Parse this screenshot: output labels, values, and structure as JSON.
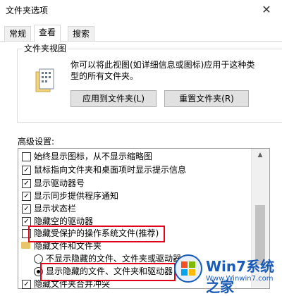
{
  "window": {
    "title": "文件夹选项",
    "close_label": "✕"
  },
  "tabs": [
    {
      "label": "常规"
    },
    {
      "label": "查看"
    },
    {
      "label": "搜索"
    }
  ],
  "folder_views": {
    "group_label": "文件夹视图",
    "description": "你可以将此视图(如详细信息或图标)应用于这种类型的所有文件夹。",
    "apply_button": "应用到文件夹(L)",
    "reset_button": "重置文件夹(R)"
  },
  "advanced": {
    "label": "高级设置:",
    "items": [
      {
        "label": "始终显示图标，从不显示缩略图",
        "type": "checkbox",
        "checked": false
      },
      {
        "label": "鼠标指向文件夹和桌面项时显示提示信息",
        "type": "checkbox",
        "checked": true
      },
      {
        "label": "显示驱动器号",
        "type": "checkbox",
        "checked": true
      },
      {
        "label": "显示同步提供程序通知",
        "type": "checkbox",
        "checked": true
      },
      {
        "label": "显示状态栏",
        "type": "checkbox",
        "checked": true
      },
      {
        "label": "隐藏空的驱动器",
        "type": "checkbox",
        "checked": true
      },
      {
        "label": "隐藏受保护的操作系统文件(推荐)",
        "type": "checkbox",
        "checked": false
      },
      {
        "label": "隐藏文件和文件夹",
        "type": "folder"
      },
      {
        "label": "不显示隐藏的文件、文件夹或驱动器",
        "type": "radio",
        "selected": false
      },
      {
        "label": "显示隐藏的文件、文件夹和驱动器",
        "type": "radio",
        "selected": true
      },
      {
        "label": "隐藏文件夹合并冲突",
        "type": "checkbox",
        "checked": true
      }
    ]
  },
  "watermark": {
    "brand": "Win7系统之家",
    "url": "Www.Winwin7.com"
  },
  "colors": {
    "highlight": "#e0001a",
    "accent": "#1a5bb5"
  }
}
